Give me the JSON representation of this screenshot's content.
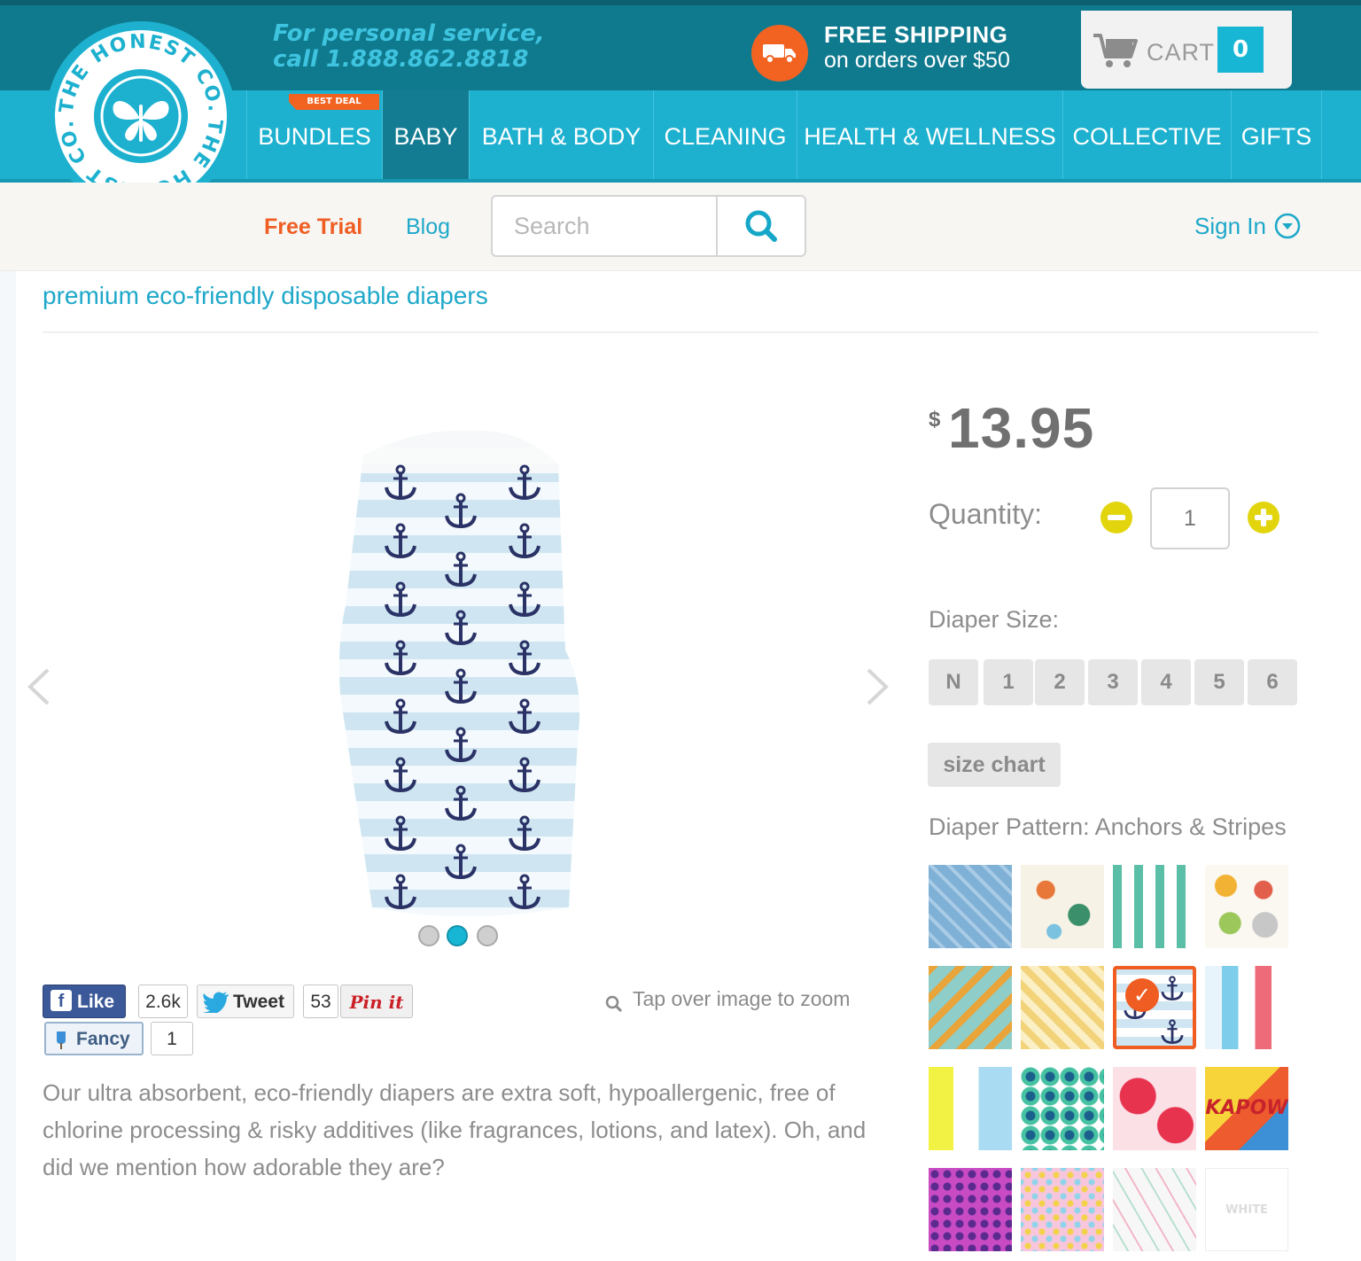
{
  "header": {
    "promo_line1": "For personal service,",
    "promo_line2": "call 1.888.862.8818",
    "shipping_title": "FREE SHIPPING",
    "shipping_sub": "on orders over $50",
    "cart_label": "CART",
    "cart_count": "0"
  },
  "logo": {
    "text_top": "THE HONEST CO.",
    "text_bottom": "THE HONEST CO."
  },
  "nav": {
    "best_deal": "BEST DEAL",
    "items": [
      {
        "label": "BUNDLES"
      },
      {
        "label": "BABY"
      },
      {
        "label": "BATH & BODY"
      },
      {
        "label": "CLEANING"
      },
      {
        "label": "HEALTH & WELLNESS"
      },
      {
        "label": "COLLECTIVE"
      },
      {
        "label": "GIFTS"
      }
    ],
    "active_index": 1
  },
  "subbar": {
    "free_trial": "Free Trial",
    "blog": "Blog",
    "search_placeholder": "Search",
    "sign_in": "Sign In"
  },
  "product": {
    "subtitle": "premium eco-friendly disposable diapers",
    "currency": "$",
    "price": "13.95",
    "quantity_label": "Quantity:",
    "quantity": "1",
    "size_label": "Diaper Size:",
    "sizes": [
      "N",
      "1",
      "2",
      "3",
      "4",
      "5",
      "6"
    ],
    "size_chart": "size chart",
    "pattern_label": "Diaper Pattern: Anchors & Stripes",
    "swatches": [
      {
        "name": "arrows"
      },
      {
        "name": "fox-forest"
      },
      {
        "name": "leaves"
      },
      {
        "name": "fruit-deer"
      },
      {
        "name": "dino-arrows"
      },
      {
        "name": "gingham"
      },
      {
        "name": "anchors-stripes",
        "selected": true
      },
      {
        "name": "stars-stripes"
      },
      {
        "name": "letters"
      },
      {
        "name": "peacock"
      },
      {
        "name": "strawberries"
      },
      {
        "name": "comic-kapow",
        "text": "KAPOW"
      },
      {
        "name": "purple-leopard"
      },
      {
        "name": "pink-hearts"
      },
      {
        "name": "dinosaurs"
      },
      {
        "name": "white",
        "text": "WHITE"
      }
    ],
    "image_slide": 2,
    "image_slide_count": 3,
    "zoom_hint": "Tap over image to zoom",
    "description": "Our ultra absorbent, eco-friendly diapers are extra soft, hypoallergenic, free of chlorine processing & risky additives (like fragrances, lotions, and latex). Oh, and did we mention how adorable they are?"
  },
  "social": {
    "like_label": "Like",
    "like_count": "2.6k",
    "tweet_label": "Tweet",
    "tweet_count": "53",
    "pin_label": "Pin it",
    "fancy_label": "Fancy",
    "fancy_count": "1"
  },
  "colors": {
    "topbar": "#0f7a8e",
    "nav": "#1db1cf",
    "accent_orange": "#ef5d22",
    "qty_yellow": "#e2d50e"
  }
}
